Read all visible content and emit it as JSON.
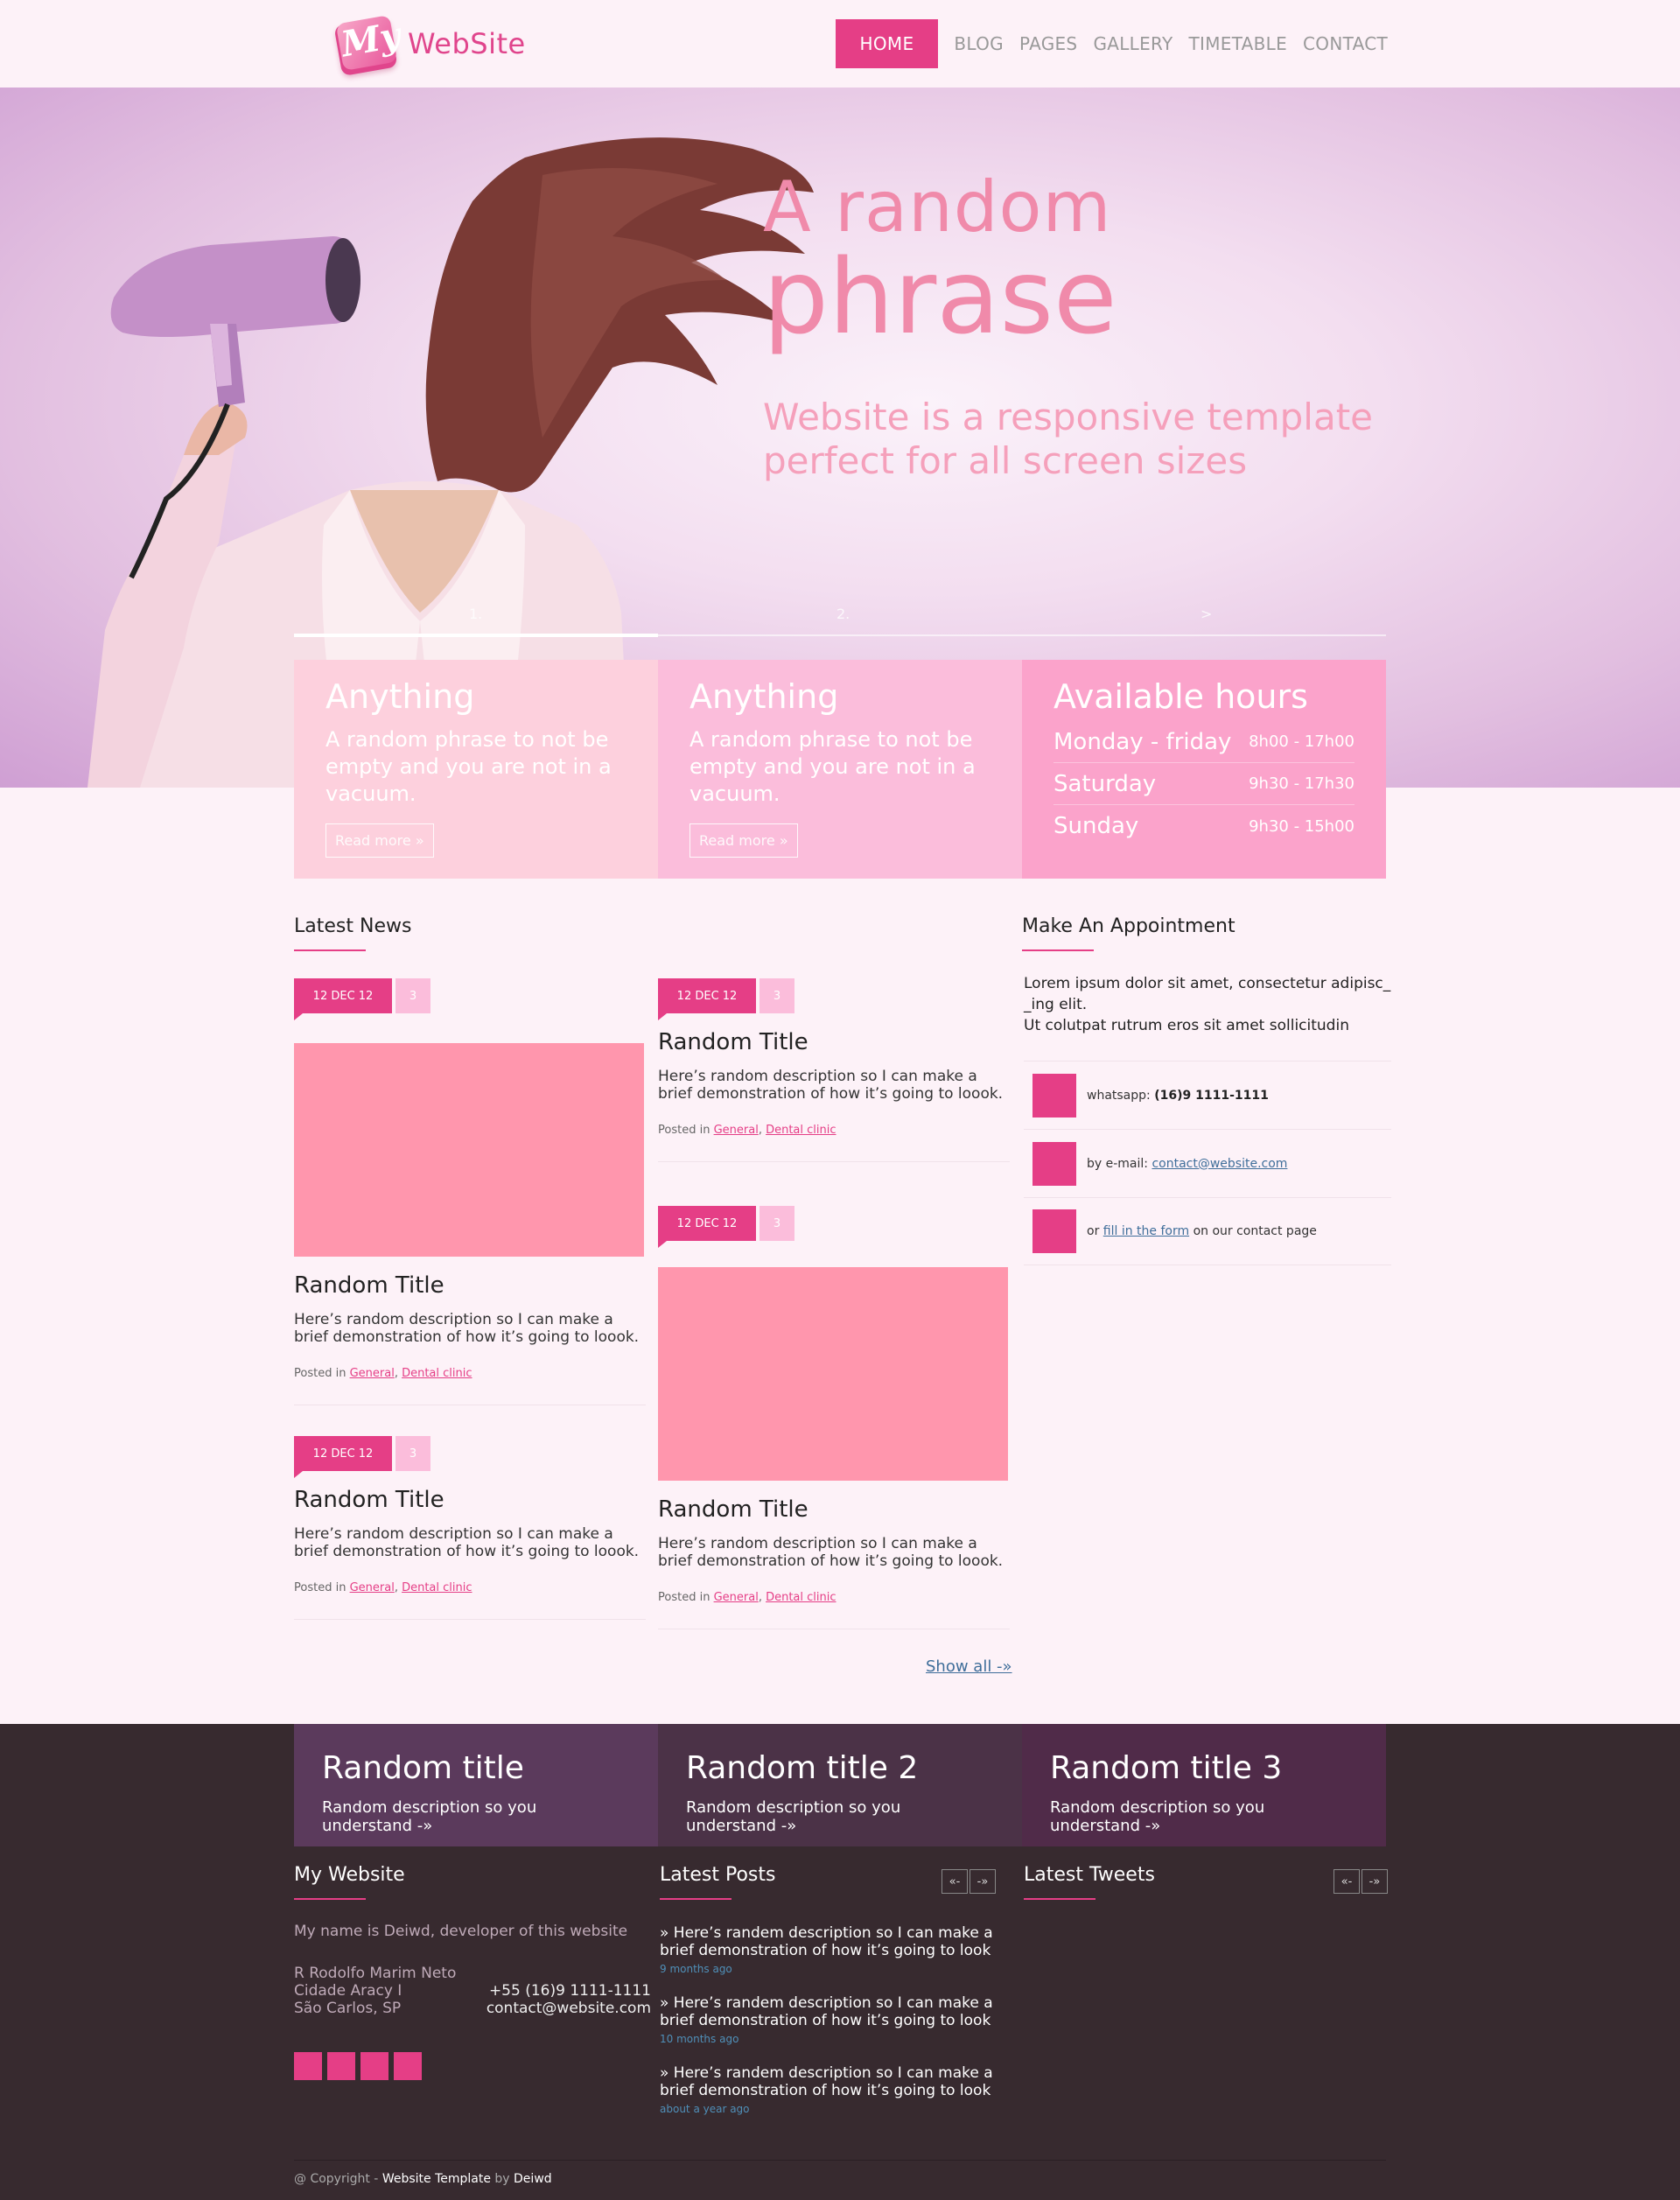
{
  "header": {
    "logo_mark": "My",
    "logo_text": "WebSite",
    "nav": [
      {
        "label": "HOME",
        "active": true
      },
      {
        "label": "BLOG"
      },
      {
        "label": "PAGES"
      },
      {
        "label": "GALLERY"
      },
      {
        "label": "TIMETABLE"
      },
      {
        "label": "CONTACT"
      }
    ]
  },
  "hero": {
    "line1": "A random",
    "line2": "phrase",
    "line3": "Website is a responsive template perfect for all screen sizes",
    "slides": [
      "1.",
      "2.",
      ">"
    ]
  },
  "features": [
    {
      "title": "Anything",
      "text": "A random phrase to not be empty and you are not in a vacuum.",
      "button": "Read more »"
    },
    {
      "title": "Anything",
      "text": "A random phrase to not be empty and you are not in a vacuum.",
      "button": "Read more »"
    }
  ],
  "hours": {
    "title": "Available hours",
    "rows": [
      {
        "day": "Monday - friday",
        "time": "8h00 - 17h00"
      },
      {
        "day": "Saturday",
        "time": "9h30 - 17h30"
      },
      {
        "day": "Sunday",
        "time": "9h30 - 15h00"
      }
    ]
  },
  "news": {
    "title": "Latest News",
    "items": [
      {
        "date": "12 DEC 12",
        "count": "3",
        "heading": "Random Title",
        "desc": "Here’s random description so I can make a brief demonstration of how it’s going to loook.",
        "posted_in": "Posted in",
        "cat1": "General",
        "cat2": "Dental clinic"
      },
      {
        "date": "12 DEC 12",
        "count": "3",
        "heading": "Random Title",
        "desc": "Here’s random description so I can make a brief demonstration of how it’s going to loook.",
        "posted_in": "Posted in",
        "cat1": "General",
        "cat2": "Dental clinic"
      },
      {
        "date": "12 DEC 12",
        "count": "3",
        "heading": "Random Title",
        "desc": "Here’s random description so I can make a brief demonstration of how it’s going to loook.",
        "posted_in": "Posted in",
        "cat1": "General",
        "cat2": "Dental clinic"
      },
      {
        "date": "12 DEC 12",
        "count": "3",
        "heading": "Random Title",
        "desc": "Here’s random description so I can make a brief demonstration of how it’s going to loook.",
        "posted_in": "Posted in",
        "cat1": "General",
        "cat2": "Dental clinic"
      }
    ],
    "show_all": "Show all -»"
  },
  "appointment": {
    "title": "Make An Appointment",
    "text1": "Lorem ipsum dolor sit amet, consectetur adipisc_ _ing elit.",
    "text2": "Ut colutpat rutrum eros sit amet sollicitudin",
    "whatsapp_label": "whatsapp:",
    "whatsapp_value": "(16)9 1111-1111",
    "email_label": "by e-mail:",
    "email_value": "contact@website.com",
    "form_pre": "or",
    "form_link": "fill in the form",
    "form_post": "on our contact page"
  },
  "promos": [
    {
      "title": "Random title",
      "desc": "Random description so you understand -»"
    },
    {
      "title": "Random title 2",
      "desc": "Random description so you understand -»"
    },
    {
      "title": "Random title 3",
      "desc": "Random description so you understand -»"
    }
  ],
  "footer": {
    "about_title": "My Website",
    "about_text": "My name is Deiwd, developer of this website",
    "address1": "R Rodolfo Marim Neto",
    "address2": "Cidade Aracy I",
    "address3": "São Carlos, SP",
    "phone": "+55 (16)9 1111-1111",
    "email": "contact@website.com",
    "posts_title": "Latest Posts",
    "pager_prev": "«-",
    "pager_next": "-»",
    "posts": [
      {
        "text": "» Here’s randem description so I can make a brief demonstration of how it’s going to look",
        "time": "9 months ago"
      },
      {
        "text": "» Here’s randem description so I can make a brief demonstration of how it’s going to look",
        "time": "10 months ago"
      },
      {
        "text": "» Here’s randem description so I can make a brief demonstration of how it’s going to look",
        "time": "about a year ago"
      }
    ],
    "tweets_title": "Latest Tweets",
    "copyright_pre": "@ Copyright -",
    "copyright_template": "Website Template",
    "copyright_by": "by",
    "copyright_author": "Deiwd"
  },
  "colors": {
    "accent": "#e53e86",
    "feature1": "#fdd0dd",
    "feature2": "#fbbddb",
    "feature3": "#fba3cb",
    "footer_bg": "#372a2f"
  }
}
